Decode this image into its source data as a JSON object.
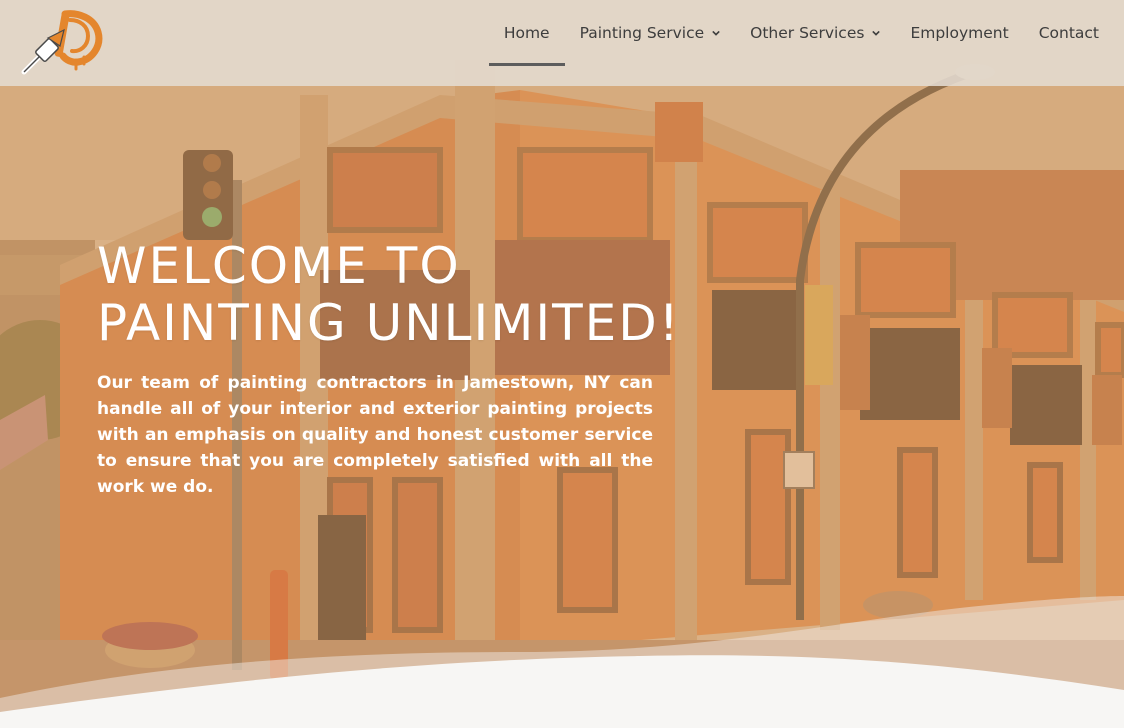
{
  "site": {
    "logo_name": "paintbrush-logo",
    "colors": {
      "accent": "#e4862d",
      "overlay": "#e2a565",
      "header_bg": "#e4dcd2",
      "nav_text": "#3d3d3d",
      "wave": "#f7f6f4"
    }
  },
  "nav": {
    "items": [
      {
        "label": "Home",
        "active": true,
        "dropdown": false
      },
      {
        "label": "Painting Service",
        "active": false,
        "dropdown": true
      },
      {
        "label": "Other Services",
        "active": false,
        "dropdown": true
      },
      {
        "label": "Employment",
        "active": false,
        "dropdown": false
      },
      {
        "label": "Contact",
        "active": false,
        "dropdown": false
      }
    ]
  },
  "hero": {
    "title_line1": "WELCOME TO",
    "title_line2": "PAINTING UNLIMITED!",
    "body": "Our team of painting contractors in Jamestown, NY can handle all of your interior and exterior painting projects with an emphasis on quality and honest customer service to ensure that you are completely satisfied with all the work we do."
  }
}
